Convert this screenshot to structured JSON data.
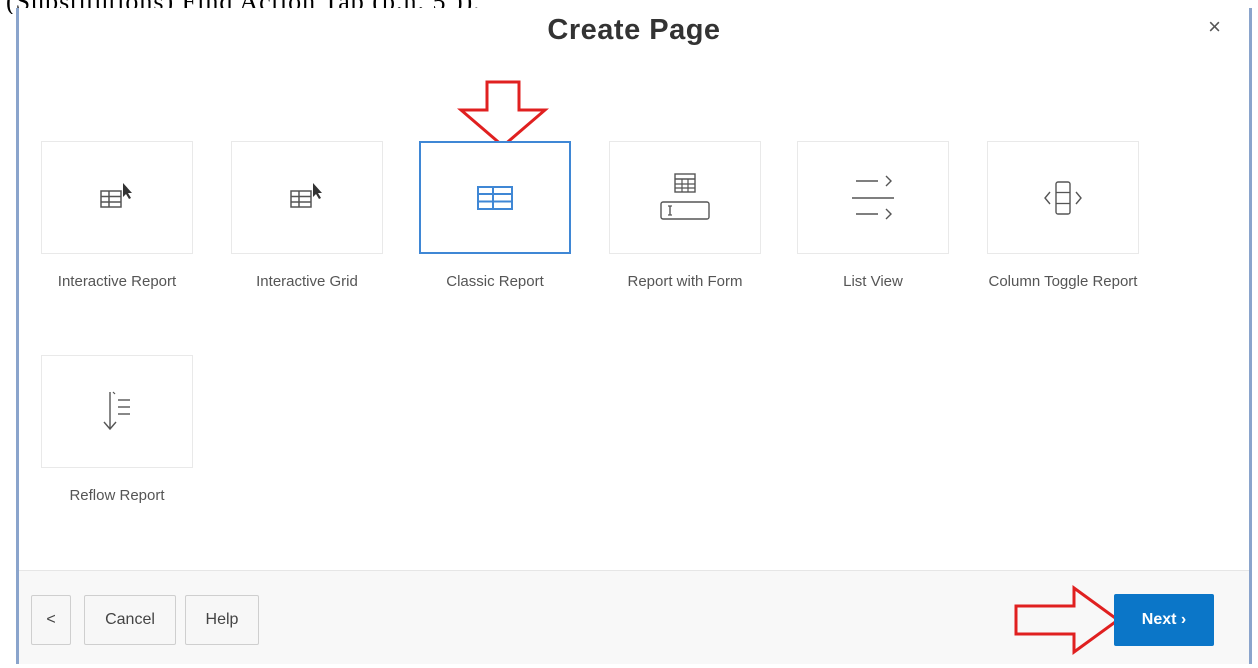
{
  "clipped_header_text": "(Substitutions) Find Action Tab (p.n. 5 )),",
  "dialog": {
    "title": "Create Page",
    "close_symbol": "×"
  },
  "tiles": [
    {
      "label": "Interactive Report",
      "icon": "interactive-report-icon"
    },
    {
      "label": "Interactive Grid",
      "icon": "interactive-grid-icon"
    },
    {
      "label": "Classic Report",
      "icon": "classic-report-icon",
      "selected": true
    },
    {
      "label": "Report with Form",
      "icon": "report-with-form-icon"
    },
    {
      "label": "List View",
      "icon": "list-view-icon"
    },
    {
      "label": "Column Toggle Report",
      "icon": "column-toggle-icon"
    },
    {
      "label": "Reflow Report",
      "icon": "reflow-report-icon"
    }
  ],
  "footer": {
    "back_symbol": "<",
    "cancel_label": "Cancel",
    "help_label": "Help",
    "next_label": "Next ›"
  },
  "annotation_color": "#e02020",
  "accent_color": "#0b76c8"
}
